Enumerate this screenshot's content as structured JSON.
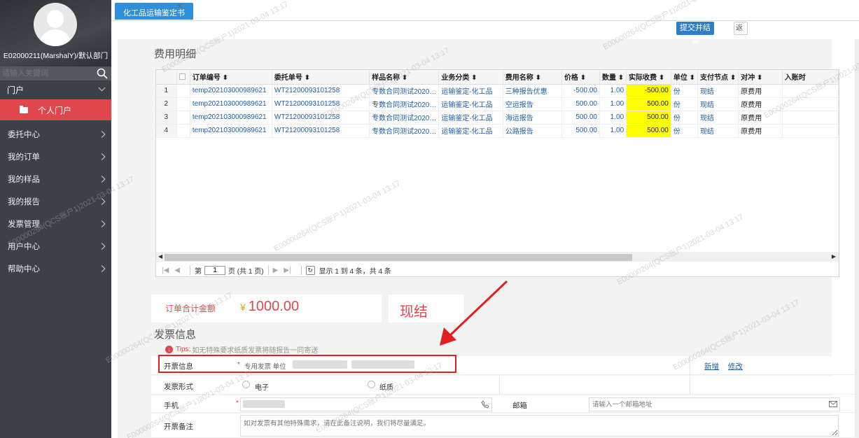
{
  "sidebar": {
    "user_name": "E02000211(MarshalY)/默认部门",
    "search_placeholder": "请输入关键词",
    "portal_label": "门户",
    "active_item": "个人门户",
    "items": [
      {
        "label": "委托中心"
      },
      {
        "label": "我的订单"
      },
      {
        "label": "我的样品"
      },
      {
        "label": "我的报告"
      },
      {
        "label": "发票管理"
      },
      {
        "label": "用户中心"
      },
      {
        "label": "帮助中心"
      }
    ]
  },
  "tabs": [
    {
      "label": "化工品运输鉴定书",
      "close": "✕"
    }
  ],
  "toolbar": {
    "submit_label": "提交并结算",
    "extra_label": "返"
  },
  "fee_section": {
    "title": "费用明细",
    "columns": [
      "",
      "",
      "订单编号 ⬍",
      "委托单号 ⬍",
      "样品名称 ⬍",
      "业务分类 ⬍",
      "费用名称 ⬍",
      "价格 ⬍",
      "数量 ⬍",
      "实际收费 ⬍",
      "单位 ⬍",
      "支付节点 ⬍",
      "对冲 ⬍",
      "入账时"
    ],
    "rows": [
      [
        "1",
        "temp202103000989621",
        "WT21200093101258",
        "专数合同测试2020…",
        "运输鉴定-化工品",
        "三种报告优惠",
        "-500.00",
        "1.00",
        "-500.00",
        "份",
        "现结",
        "原费用"
      ],
      [
        "2",
        "temp202103000989621",
        "WT21200093101258",
        "专数合同测试2020…",
        "运输鉴定-化工品",
        "空运报告",
        "500.00",
        "1.00",
        "500.00",
        "份",
        "现结",
        "原费用"
      ],
      [
        "3",
        "temp202103000989621",
        "WT21200093101258",
        "专数合同测试2020…",
        "运输鉴定-化工品",
        "海运报告",
        "500.00",
        "1.00",
        "500.00",
        "份",
        "现结",
        "原费用"
      ],
      [
        "4",
        "temp202103000989621",
        "WT21200093101258",
        "专数合同测试2020…",
        "运输鉴定-化工品",
        "公路报告",
        "500.00",
        "1.00",
        "500.00",
        "份",
        "现结",
        "原费用"
      ]
    ],
    "pager": {
      "page_prefix": "第",
      "page_value": "1",
      "page_suffix": "页 (共 1 页)",
      "summary": "显示 1 到 4 条，共 4 条"
    }
  },
  "total": {
    "label": "订单合计金额",
    "currency": "¥",
    "amount": "1000.00",
    "settlement": "现结"
  },
  "invoice": {
    "title": "发票信息",
    "tips_prefix": "Tips:",
    "tips_text": "如无特殊要求纸质发票将随报告一同寄送",
    "invoice_info_label": "开票信息",
    "invoice_info_value": "专用发票 单位",
    "add_link": "新增",
    "edit_link": "修改",
    "form_label": "发票形式",
    "option_electronic": "电子",
    "option_paper": "纸质",
    "phone_label": "手机",
    "email_label": "邮箱",
    "email_placeholder": "请输入一个邮箱地址",
    "note_label": "开票备注",
    "note_placeholder": "如对发票有其他特殊需求，请在此备注说明，我们将尽量满足。"
  },
  "watermark": "E00000264(QCS账户1)2021-03-04 13:17",
  "colors": {
    "accent_red": "#e0474c",
    "primary_blue": "#2f7cc7",
    "highlight_yellow": "#ffff00",
    "sidebar_bg": "#3d4046"
  }
}
